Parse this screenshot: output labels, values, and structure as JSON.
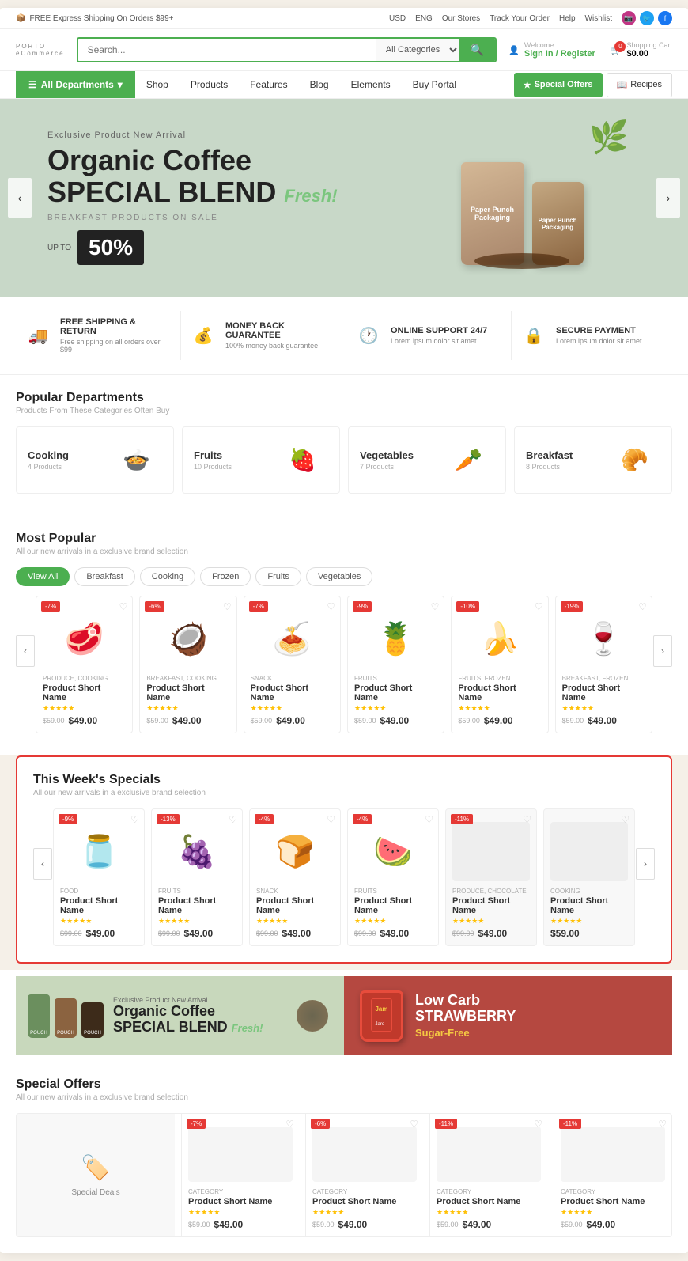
{
  "topbar": {
    "shipping_text": "FREE Express Shipping On Orders $99+",
    "currency": "USD",
    "language": "ENG",
    "stores": "Our Stores",
    "track": "Track Your Order",
    "help": "Help",
    "wishlist": "Wishlist"
  },
  "header": {
    "logo": "PORTO",
    "logo_sub": "eCommerce",
    "search_placeholder": "Search...",
    "search_category": "All Categories",
    "account_label": "Welcome",
    "sign_in": "Sign In / Register",
    "cart_label": "Shopping Cart",
    "cart_amount": "$0.00"
  },
  "nav": {
    "all_departments": "All Departments",
    "links": [
      "Shop",
      "Products",
      "Features",
      "Blog",
      "Elements",
      "Buy Portal"
    ],
    "special_offers": "Special Offers",
    "recipes": "Recipes"
  },
  "hero": {
    "subtitle": "Exclusive Product New Arrival",
    "title_line1": "Organic Coffee",
    "title_line2": "SPECIAL BLEND",
    "fresh": "Fresh!",
    "desc": "BREAKFAST PRODUCTS ON SALE",
    "sale_text": "UP TO",
    "sale_badge": "50%",
    "nav_left": "‹",
    "nav_right": "›"
  },
  "features": [
    {
      "icon": "🚚",
      "title": "FREE SHIPPING & RETURN",
      "desc": "Free shipping on all orders over $99"
    },
    {
      "icon": "💰",
      "title": "MONEY BACK GUARANTEE",
      "desc": "100% money back guarantee"
    },
    {
      "icon": "🕐",
      "title": "ONLINE SUPPORT 24/7",
      "desc": "Lorem ipsum dolor sit amet"
    },
    {
      "icon": "🔒",
      "title": "SECURE PAYMENT",
      "desc": "Lorem ipsum dolor sit amet"
    }
  ],
  "departments": {
    "title": "Popular Departments",
    "subtitle": "Products From These Categories Often Buy",
    "items": [
      {
        "name": "Cooking",
        "count": "4 Products",
        "emoji": "🍲"
      },
      {
        "name": "Fruits",
        "count": "10 Products",
        "emoji": "🍓"
      },
      {
        "name": "Vegetables",
        "count": "7 Products",
        "emoji": "🥕"
      },
      {
        "name": "Breakfast",
        "count": "8 Products",
        "emoji": "🥐"
      }
    ]
  },
  "most_popular": {
    "title": "Most Popular",
    "subtitle": "All our new arrivals in a exclusive brand selection",
    "filters": [
      "View All",
      "Breakfast",
      "Cooking",
      "Frozen",
      "Fruits",
      "Vegetables"
    ],
    "active_filter": "View All",
    "products": [
      {
        "badge": "-7%",
        "category": "PRODUCE, COOKING",
        "name": "Product Short Name",
        "price_old": "$59.00",
        "price_new": "$49.00",
        "emoji": "🥩"
      },
      {
        "badge": "-6%",
        "category": "BREAKFAST, COOKING",
        "name": "Product Short Name",
        "price_old": "$59.00",
        "price_new": "$49.00",
        "emoji": "🥥"
      },
      {
        "badge": "-7%",
        "category": "SNACK",
        "name": "Product Short Name",
        "price_old": "$59.00",
        "price_new": "$49.00",
        "emoji": "🍝"
      },
      {
        "badge": "-9%",
        "category": "FRUITS",
        "name": "Product Short Name",
        "price_old": "$59.00",
        "price_new": "$49.00",
        "emoji": "🍍"
      },
      {
        "badge": "-10%",
        "category": "FRUITS, FROZEN",
        "name": "Product Short Name",
        "price_old": "$59.00",
        "price_new": "$49.00",
        "emoji": "🍌"
      },
      {
        "badge": "-19%",
        "category": "BREAKFAST, FROZEN",
        "name": "Product Short Name",
        "price_old": "$59.00",
        "price_new": "$49.00",
        "emoji": "🍷"
      }
    ]
  },
  "weeks_specials": {
    "title": "This Week's Specials",
    "subtitle": "All our new arrivals in a exclusive brand selection",
    "products": [
      {
        "badge": "-9%",
        "category": "FOOD",
        "name": "Product Short Name",
        "price_old": "$99.00",
        "price_new": "$49.00",
        "emoji": "🫙"
      },
      {
        "badge": "-13%",
        "category": "FRUITS",
        "name": "Product Short Name",
        "price_old": "$99.00",
        "price_new": "$49.00",
        "emoji": "🍇"
      },
      {
        "badge": "-4%",
        "category": "SNACK",
        "name": "Product Short Name",
        "price_old": "$99.00",
        "price_new": "$49.00",
        "emoji": "🍞"
      },
      {
        "badge": "-4%",
        "category": "FRUITS",
        "name": "Product Short Name",
        "price_old": "$99.00",
        "price_new": "$49.00",
        "emoji": "🍉"
      },
      {
        "badge": "-11%",
        "category": "PRODUCE, CHOCOLATE",
        "name": "Product Short Name",
        "price_old": "$99.00",
        "price_new": "$49.00",
        "emoji": "🟩"
      },
      {
        "badge": "",
        "category": "COOKING",
        "name": "Product Short Name",
        "price_old": "",
        "price_new": "$59.00",
        "emoji": ""
      }
    ]
  },
  "promo": {
    "banner1": {
      "subtitle": "Exclusive Product New Arrival",
      "title_line1": "Organic Coffee",
      "title_line2": "SPECIAL BLEND",
      "fresh": "Fresh!"
    },
    "banner2": {
      "title_line1": "Low Carb",
      "title_line2": "STRAWBERRY",
      "sugar_free": "Sugar-Free"
    }
  },
  "special_offers": {
    "title": "Special Offers",
    "subtitle": "All our new arrivals in a exclusive brand selection",
    "badges": [
      "-7%",
      "-6%",
      "-11%",
      "-11%"
    ]
  }
}
